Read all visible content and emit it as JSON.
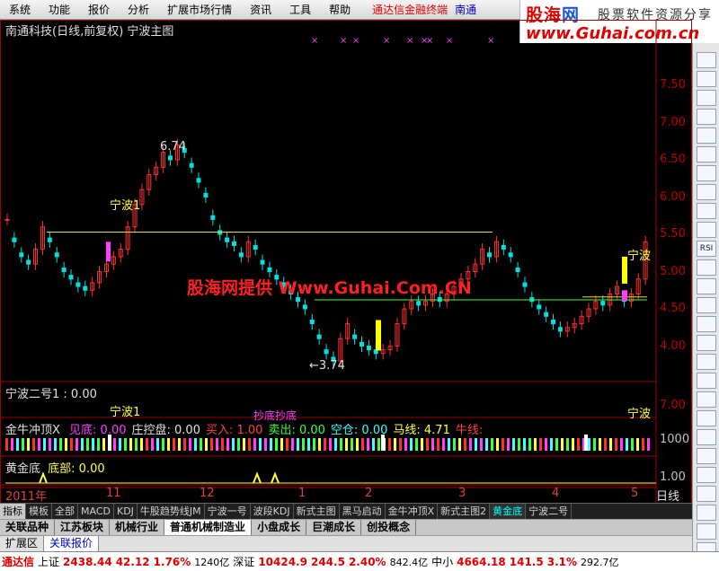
{
  "menu": {
    "items": [
      "系统",
      "功能",
      "报价",
      "分析",
      "扩展市场行情",
      "资讯",
      "工具",
      "帮助"
    ],
    "brand": "通达信金融终端",
    "brand2": "南通"
  },
  "logo": {
    "main_a": "股海",
    "main_b": "网",
    "sub": "股票软件资源分享",
    "url": "www.Guhai.com.cn"
  },
  "chart": {
    "title": "南通科技(日线,前复权) 宁波主图",
    "watermark": "股海网提供 Www.Guhai.Com.CN",
    "high_label": "6.74",
    "low_label": "3.74",
    "label_ningbo1": "宁波1",
    "label_ningbo_right": "宁波",
    "label_chaodi": "抄底",
    "price_axis": [
      "7.50",
      "7.00",
      "6.50",
      "6.00",
      "5.50",
      "5.00",
      "4.50",
      "4.00"
    ]
  },
  "panels": {
    "p1_title": "宁波二号1 : 0.00",
    "p1_label": "宁波1",
    "p1_label2": "抄底抄底",
    "p1_label_right": "宁波",
    "p1_axis": "7.00",
    "p2_name": "金牛冲顶X",
    "p2_fields": [
      {
        "label": "见底:",
        "value": "0.00",
        "color": "#ff40ff"
      },
      {
        "label": "庄控盘:",
        "value": "0.00",
        "color": "#e0e0e0"
      },
      {
        "label": "买入:",
        "value": "1.00",
        "color": "#ff4040"
      },
      {
        "label": "卖出:",
        "value": "0.00",
        "color": "#40ff40"
      },
      {
        "label": "空仓:",
        "value": "0.00",
        "color": "#40ffff"
      },
      {
        "label": "马线:",
        "value": "4.71",
        "color": "#ffff40"
      },
      {
        "label": "牛线:",
        "value": "",
        "color": "#ff4040"
      }
    ],
    "p2_axis": "1000",
    "p3_title": "黄金底",
    "p3_field": "底部: 0.00",
    "p3_axis": "1.00",
    "date_axis": [
      {
        "label": "2011年",
        "color": "#e04040"
      },
      {
        "label": "11",
        "color": "#e04040"
      },
      {
        "label": "12",
        "color": "#e04040"
      },
      {
        "label": "1",
        "color": "#e04040"
      },
      {
        "label": "2",
        "color": "#e04040"
      },
      {
        "label": "3",
        "color": "#e04040"
      },
      {
        "label": "4",
        "color": "#e04040"
      },
      {
        "label": "5",
        "color": "#e04040"
      }
    ],
    "period": "日线"
  },
  "tabs": [
    "指标",
    "模板",
    "全部",
    "MACD",
    "KDJ",
    "牛股趋势线JM",
    "宁波一号",
    "波段KDJ",
    "新式主图",
    "黑马启动",
    "金牛冲顶X",
    "新式主图2",
    "黄金底",
    "宁波二号"
  ],
  "tab_active": "黄金底",
  "sectors": [
    "关联品种",
    "江苏板块",
    "机械行业",
    "普通机械制造业",
    "小盘成长",
    "巨潮成长",
    "创投概念"
  ],
  "sector_active": "普通机械制造业",
  "subtabs": [
    "扩展区",
    "关联报价"
  ],
  "subtab_active": "关联报价",
  "status": {
    "brand": "通达信",
    "sh_name": "上证",
    "sh_value": "2438.44",
    "sh_change": "42.12",
    "sh_pct": "1.76%",
    "sh_vol": "1240亿",
    "sz_name": "深证",
    "sz_value": "10424.9",
    "sz_change": "244.5",
    "sz_pct": "2.40%",
    "sz_vol": "842.4亿",
    "zx_name": "中小",
    "zx_value": "4664.18",
    "zx_change": "141.5",
    "zx_pct": "3.1%",
    "zx_vol": "292.7亿"
  },
  "right_toolbar": [
    "",
    "",
    "",
    "",
    "",
    "",
    "",
    "",
    "",
    "",
    "RSI",
    "",
    "",
    "",
    "",
    "",
    "",
    "",
    "",
    "",
    "",
    "",
    "",
    "",
    "",
    "",
    ""
  ]
}
